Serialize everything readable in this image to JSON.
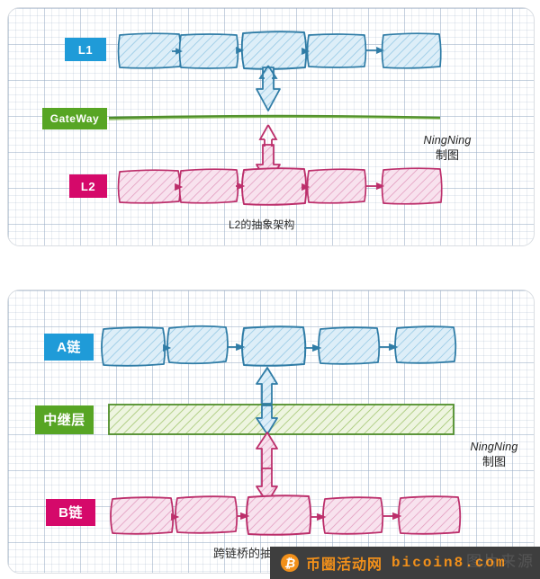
{
  "figure": {
    "background": "#ffffff",
    "panel_border": "#d9dde2",
    "grid_color": "#96aac3"
  },
  "palette": {
    "blue": "#1f9bd8",
    "blue_stroke": "#2f7ca6",
    "blue_fill": "#d8ecf7",
    "green": "#57a524",
    "green_stroke": "#4f8e2a",
    "green_fill": "#e4f0cf",
    "pink": "#d5096a",
    "pink_stroke": "#bc2f6b",
    "pink_fill": "#f6dbe8",
    "text": "#2b2b2b"
  },
  "panel_one": {
    "name": "L2 abstract architecture",
    "caption": "L2的抽象架构",
    "rows": [
      {
        "id": "l1",
        "label": "L1",
        "label_color": "#1f9bd8",
        "kind": "chain",
        "block_count": 5,
        "blocks": [
          "",
          "",
          "",
          "",
          ""
        ]
      },
      {
        "id": "gateway",
        "label": "GateWay",
        "label_color": "#57a524",
        "kind": "line"
      },
      {
        "id": "l2",
        "label": "L2",
        "label_color": "#d5096a",
        "kind": "chain",
        "block_count": 5,
        "blocks": [
          "",
          "",
          "",
          "",
          ""
        ]
      }
    ],
    "connectors": [
      {
        "id": "l1-to-gateway",
        "direction": "bidirectional",
        "color": "#2f7ca6"
      },
      {
        "id": "gateway-to-l2",
        "direction": "bidirectional",
        "color": "#bc2f6b"
      }
    ],
    "signature": {
      "line1": "NingNing",
      "line2": "制图"
    }
  },
  "panel_two": {
    "name": "Cross-chain bridge abstract architecture",
    "caption": "跨链桥的抽象架构",
    "rows": [
      {
        "id": "chain-a",
        "label": "A链",
        "label_color": "#1f9bd8",
        "kind": "chain",
        "block_count": 5,
        "blocks": [
          "",
          "",
          "",
          "",
          ""
        ]
      },
      {
        "id": "relay-layer",
        "label": "中继层",
        "label_color": "#57a524",
        "kind": "bar"
      },
      {
        "id": "chain-b",
        "label": "B链",
        "label_color": "#d5096a",
        "kind": "chain",
        "block_count": 5,
        "blocks": [
          "",
          "",
          "",
          "",
          ""
        ]
      }
    ],
    "connectors": [
      {
        "id": "chain-a-to-relay",
        "direction": "bidirectional",
        "color": "#2f7ca6"
      },
      {
        "id": "relay-to-chain-b",
        "direction": "bidirectional",
        "color": "#bc2f6b"
      }
    ],
    "signature": {
      "line1": "NingNing",
      "line2": "制图"
    }
  },
  "watermark": {
    "icon": "bitcoin-icon",
    "icon_glyph": "₿",
    "site_name": "币圈活动网",
    "url": "bicoin8.com",
    "ghost_text": "图片来源",
    "background": "#3e3e3e",
    "accent": "#f2901a"
  }
}
